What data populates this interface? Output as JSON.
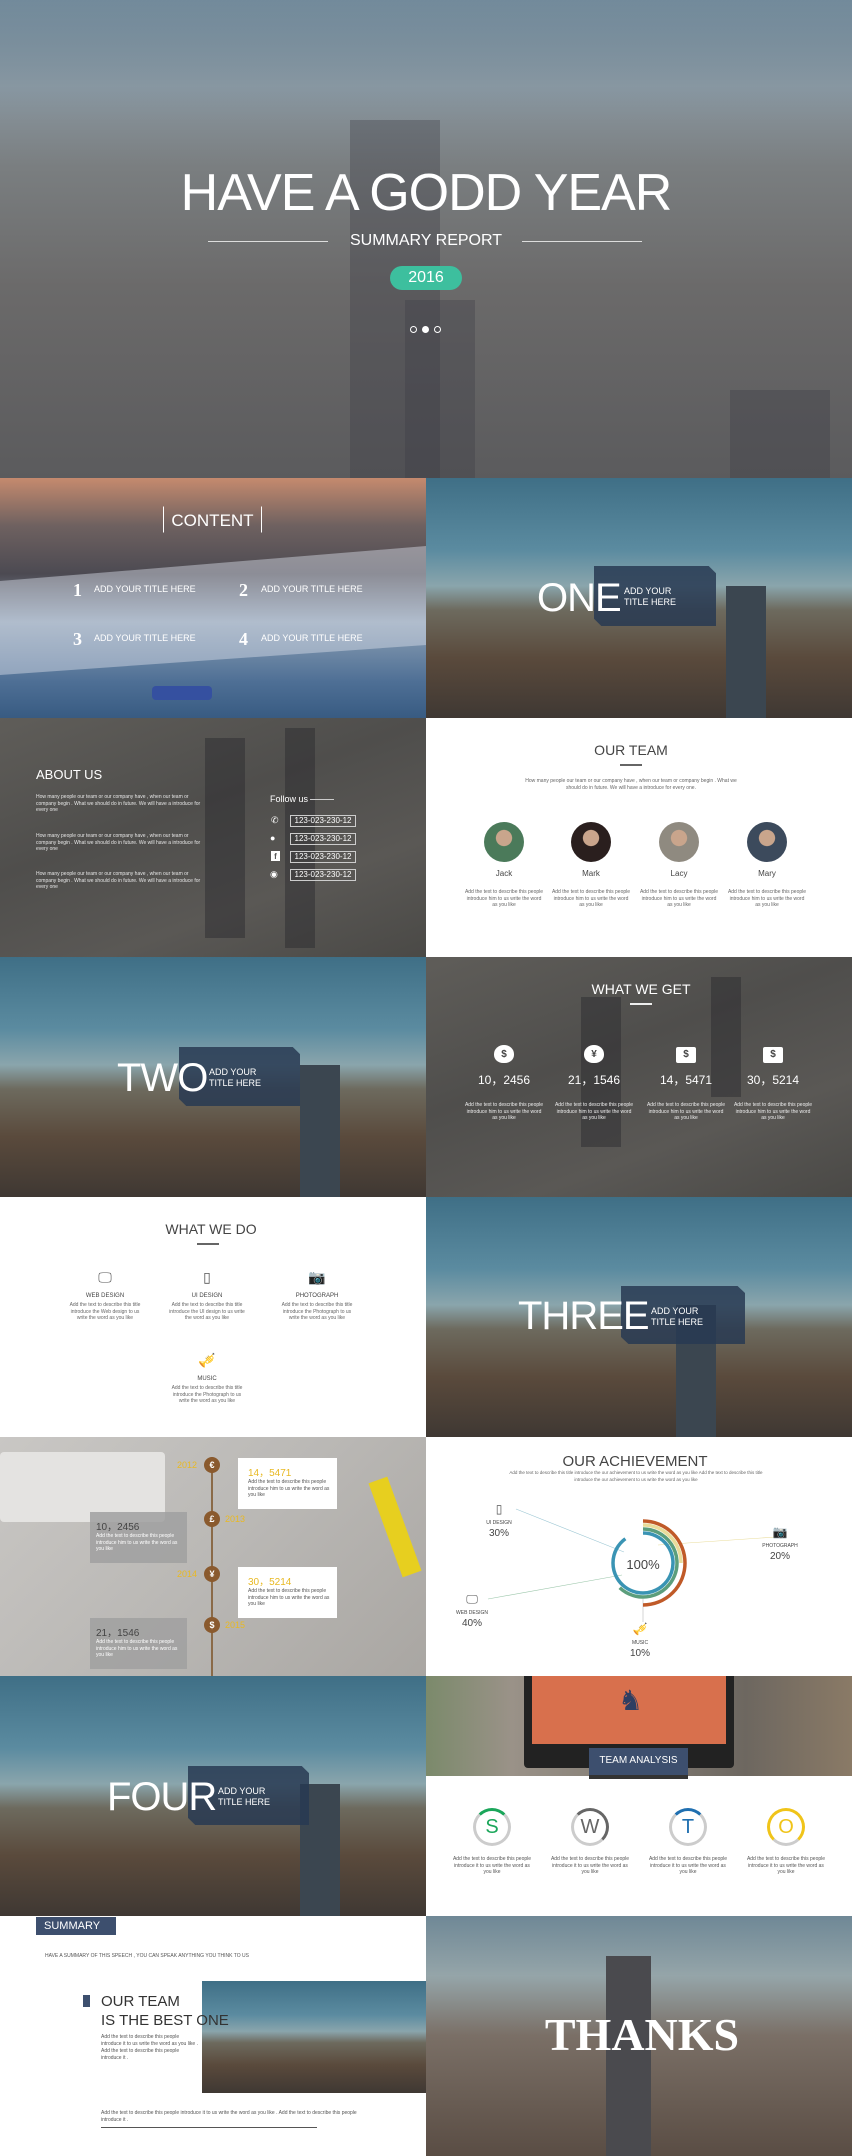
{
  "hero": {
    "title": "HAVE A GODD YEAR",
    "subtitle": "SUMMARY REPORT",
    "year": "2016",
    "year_color": "#3dbf9e"
  },
  "content": {
    "title": "CONTENT",
    "items": [
      {
        "num": "1",
        "label": "ADD YOUR TITLE HERE"
      },
      {
        "num": "2",
        "label": "ADD YOUR TITLE HERE"
      },
      {
        "num": "3",
        "label": "ADD YOUR TITLE HERE"
      },
      {
        "num": "4",
        "label": "ADD YOUR TITLE HERE"
      }
    ]
  },
  "section_one": {
    "word": "ONE",
    "label": "ADD YOUR TITLE HERE"
  },
  "section_two": {
    "word": "TWO",
    "label": "ADD YOUR TITLE HERE"
  },
  "section_three": {
    "word": "THREE",
    "label": "ADD YOUR TITLE HERE"
  },
  "section_four": {
    "word": "FOUR",
    "label": "ADD YOUR TITLE HERE"
  },
  "about": {
    "title": "ABOUT US",
    "paragraphs": [
      "How many people our team or our company have , when our team or company begin . What we should do in future. We will have a introduce for every one",
      "How many people our team or our company have , when our team or company begin . What we should do in future. We will have a introduce for every one",
      "How many people our team or our company have , when our team or company begin . What we should do in future. We will have a introduce for every one"
    ],
    "follow_label": "Follow us",
    "contacts": [
      {
        "icon": "phone-icon",
        "value": "123-023-230-12"
      },
      {
        "icon": "wechat-icon",
        "value": "123-023-230-12"
      },
      {
        "icon": "facebook-icon",
        "value": "123-023-230-12"
      },
      {
        "icon": "weibo-icon",
        "value": "123-023-230-12"
      }
    ]
  },
  "team": {
    "title": "OUR TEAM",
    "intro": "How many people our team or our company have , when our team or company begin . What we should do in future. We will have a introduce for every one.",
    "members": [
      {
        "name": "Jack",
        "desc": "Add the text to describe this people introduce him to us write the word as you like"
      },
      {
        "name": "Mark",
        "desc": "Add the text to describe this people introduce him to us write the word as you like"
      },
      {
        "name": "Lacy",
        "desc": "Add the text to describe this people introduce him to us write the word as you like"
      },
      {
        "name": "Mary",
        "desc": "Add the text to describe this people introduce him to us write the word as you like"
      }
    ]
  },
  "get": {
    "title": "WHAT WE GET",
    "items": [
      {
        "icon": "money-bag-dollar-icon",
        "glyph": "$",
        "value": "10，2456",
        "desc": "Add the text to describe this people introduce him to us write the word as you like"
      },
      {
        "icon": "money-bag-yen-icon",
        "glyph": "¥",
        "value": "21，1546",
        "desc": "Add the text to describe this people introduce him to us write the word as you like"
      },
      {
        "icon": "briefcase-dollar-icon",
        "glyph": "$",
        "value": "14，5471",
        "desc": "Add the text to describe this people introduce him to us write the word as you like"
      },
      {
        "icon": "briefcase-coin-icon",
        "glyph": "$",
        "value": "30，5214",
        "desc": "Add the text to describe this people introduce him to us write the word as you like"
      }
    ]
  },
  "do": {
    "title": "WHAT WE DO",
    "items": [
      {
        "icon": "monitor-icon",
        "label": "WEB DESIGN",
        "desc": "Add the text to describe this title introduce the Web design to us write the word as you like"
      },
      {
        "icon": "phone-icon",
        "label": "UI DESIGN",
        "desc": "Add the text to describe this title introduce the UI design to us write the word as you like"
      },
      {
        "icon": "camera-icon",
        "label": "PHOTOGRAPH",
        "desc": "Add the text to describe this title introduce the Photograph to us write the word as you like"
      },
      {
        "icon": "trumpet-icon",
        "label": "MUSIC",
        "desc": "Add the text to describe this title introduce the Photograph to us write the word as you like"
      }
    ]
  },
  "timeline": {
    "accent": "#e8b923",
    "events": [
      {
        "year": "2012",
        "symbol": "€",
        "value": "14，5471",
        "desc": "Add the text to describe this people introduce him to us write the word as you like"
      },
      {
        "year": "2013",
        "symbol": "£",
        "value": "10，2456",
        "desc": "Add the text to describe this people introduce him to us write the word as you like"
      },
      {
        "year": "2014",
        "symbol": "¥",
        "value": "30，5214",
        "desc": "Add the text to describe this people introduce him to us write the word as you like"
      },
      {
        "year": "2015",
        "symbol": "$",
        "value": "21，1546",
        "desc": "Add the text to describe this people introduce him to us write the word as you like"
      }
    ]
  },
  "achievement": {
    "title": "OUR ACHIEVEMENT",
    "subtitle": "Add the text to describe this title introduce the our achievement to us write the word as you like Add the text to describe this title introduce the our achievement to us write the word as you like",
    "total": "100%",
    "items": [
      {
        "label": "UI DESIGN",
        "value": "30%",
        "percent": 30,
        "color": "#3a94b4"
      },
      {
        "label": "WEB DESIGN",
        "value": "40%",
        "percent": 40,
        "color": "#5c9e7c"
      },
      {
        "label": "PHOTOGRAPH",
        "value": "20%",
        "percent": 20,
        "color": "#e9dc9a"
      },
      {
        "label": "MUSIC",
        "value": "10%",
        "percent": 10,
        "color": "#c05a28"
      }
    ]
  },
  "analysis": {
    "title": "TEAM ANALYSIS",
    "items": [
      {
        "letter": "S",
        "color": "#1aa65a",
        "desc": "Add the text to describe this people introduce it to us write the word as you like"
      },
      {
        "letter": "W",
        "color": "#666666",
        "desc": "Add the text to describe this people introduce it to us write the word as you like"
      },
      {
        "letter": "T",
        "color": "#1f6fb0",
        "desc": "Add the text to describe this people introduce it to us write the word as you like"
      },
      {
        "letter": "O",
        "color": "#f0c419",
        "desc": "Add the text to describe this people introduce it to us write the word as you like"
      }
    ]
  },
  "summary": {
    "title": "SUMMARY",
    "subtitle": "HAVE A SUMMARY OF THIS SPEECH , YOU CAN SPEAK ANYTHING YOU THINK TO US",
    "headline_1": "OUR TEAM",
    "headline_2": "IS THE BEST ONE",
    "desc": "Add the text to describe this people introduce it to us write the word as you like . Add the text to describe this people introduce it .",
    "footer": "Add the text to describe this people introduce it to us write the word as you like . Add the text to describe this people introduce it ."
  },
  "thanks": {
    "word": "THANKS"
  }
}
